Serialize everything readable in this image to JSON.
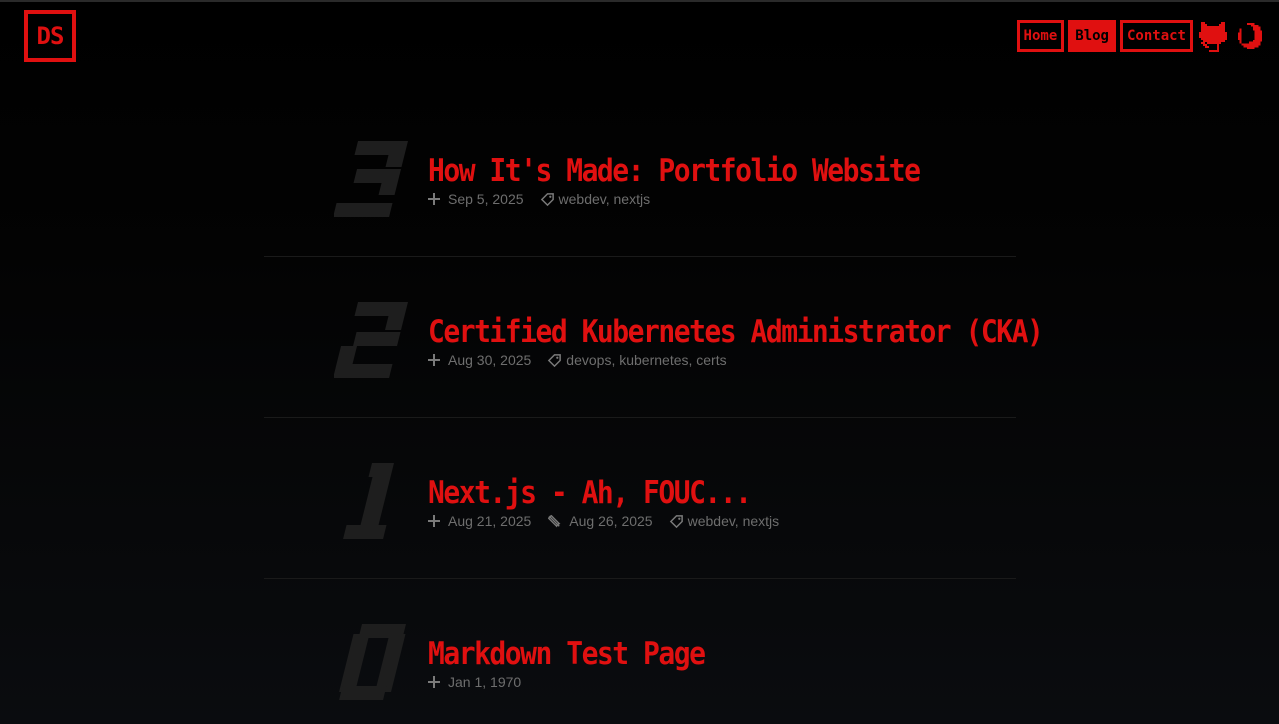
{
  "header": {
    "logo": "DS",
    "nav": [
      {
        "label": "Home",
        "active": false
      },
      {
        "label": "Blog",
        "active": true
      },
      {
        "label": "Contact",
        "active": false
      }
    ],
    "icons": [
      "github-icon",
      "moon-icon"
    ]
  },
  "accent_color": "#e01010",
  "posts": [
    {
      "number": "3",
      "title": "How It's Made: Portfolio Website",
      "created": "Sep 5, 2025",
      "updated": "",
      "tags": "webdev, nextjs"
    },
    {
      "number": "2",
      "title": "Certified Kubernetes Administrator (CKA)",
      "created": "Aug 30, 2025",
      "updated": "",
      "tags": "devops, kubernetes, certs"
    },
    {
      "number": "1",
      "title": "Next.js - Ah, FOUC...",
      "created": "Aug 21, 2025",
      "updated": "Aug 26, 2025",
      "tags": "webdev, nextjs"
    },
    {
      "number": "0",
      "title": "Markdown Test Page",
      "created": "Jan 1, 1970",
      "updated": "",
      "tags": ""
    }
  ]
}
